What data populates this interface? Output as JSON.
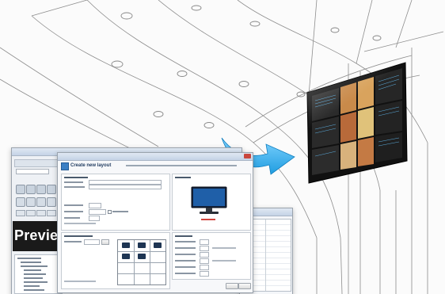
{
  "left_app": {
    "preview_label": "Preview"
  },
  "dialog": {
    "title_label": "Create new layout"
  },
  "colors": {
    "arrow_blue": "#1f9de0",
    "window_frame": "#9aa3ad",
    "preview_bg": "#1a1a1a",
    "videowall_frame": "#111111"
  },
  "icons": {
    "arrow": "curved-arrow-icon",
    "monitor": "monitor-icon",
    "grid_screen": "screen-tile-icon"
  }
}
